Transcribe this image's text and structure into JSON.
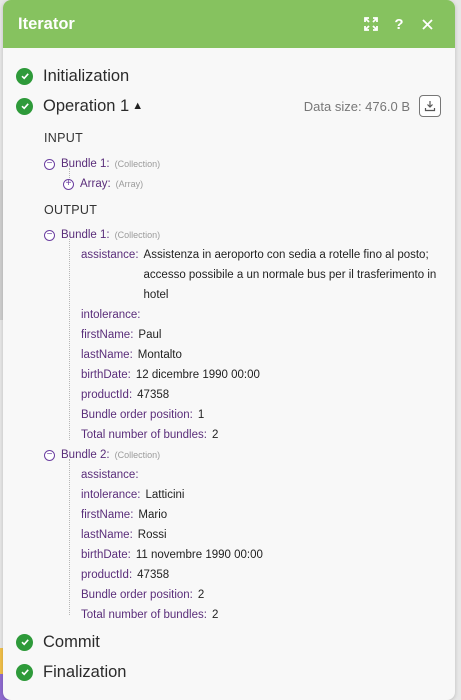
{
  "header": {
    "title": "Iterator"
  },
  "phases": {
    "initialization": "Initialization",
    "operation": "Operation 1",
    "commit": "Commit",
    "finalization": "Finalization"
  },
  "data_size": "Data size: 476.0 B",
  "input": {
    "label": "INPUT",
    "bundle_key": "Bundle 1:",
    "bundle_type": "(Collection)",
    "array_key": "Array:",
    "array_type": "(Array)"
  },
  "output": {
    "label": "OUTPUT",
    "bundles": [
      {
        "key": "Bundle 1:",
        "type": "(Collection)",
        "fields": {
          "assistance_key": "assistance:",
          "assistance_val": "Assistenza in aeroporto con sedia a rotelle fino al posto; accesso possibile a un normale bus per il trasferimento in hotel",
          "intolerance_key": "intolerance:",
          "intolerance_val": "",
          "firstName_key": "firstName:",
          "firstName_val": "Paul",
          "lastName_key": "lastName:",
          "lastName_val": "Montalto",
          "birthDate_key": "birthDate:",
          "birthDate_val": "12 dicembre 1990 00:00",
          "productId_key": "productId:",
          "productId_val": "47358",
          "order_key": "Bundle order position:",
          "order_val": "1",
          "total_key": "Total number of bundles:",
          "total_val": "2"
        }
      },
      {
        "key": "Bundle 2:",
        "type": "(Collection)",
        "fields": {
          "assistance_key": "assistance:",
          "assistance_val": "",
          "intolerance_key": "intolerance:",
          "intolerance_val": "Latticini",
          "firstName_key": "firstName:",
          "firstName_val": "Mario",
          "lastName_key": "lastName:",
          "lastName_val": "Rossi",
          "birthDate_key": "birthDate:",
          "birthDate_val": "11 novembre 1990 00:00",
          "productId_key": "productId:",
          "productId_val": "47358",
          "order_key": "Bundle order position:",
          "order_val": "2",
          "total_key": "Total number of bundles:",
          "total_val": "2"
        }
      }
    ]
  },
  "colors": {
    "header": "#86c25f",
    "success": "#2e9a3a",
    "key": "#5a2d7a",
    "toggle": "#6b3fa0"
  },
  "icons": {
    "expand": "expand-icon",
    "help": "help-icon",
    "close": "close-icon",
    "check": "check-circle-icon",
    "download": "download-icon"
  }
}
